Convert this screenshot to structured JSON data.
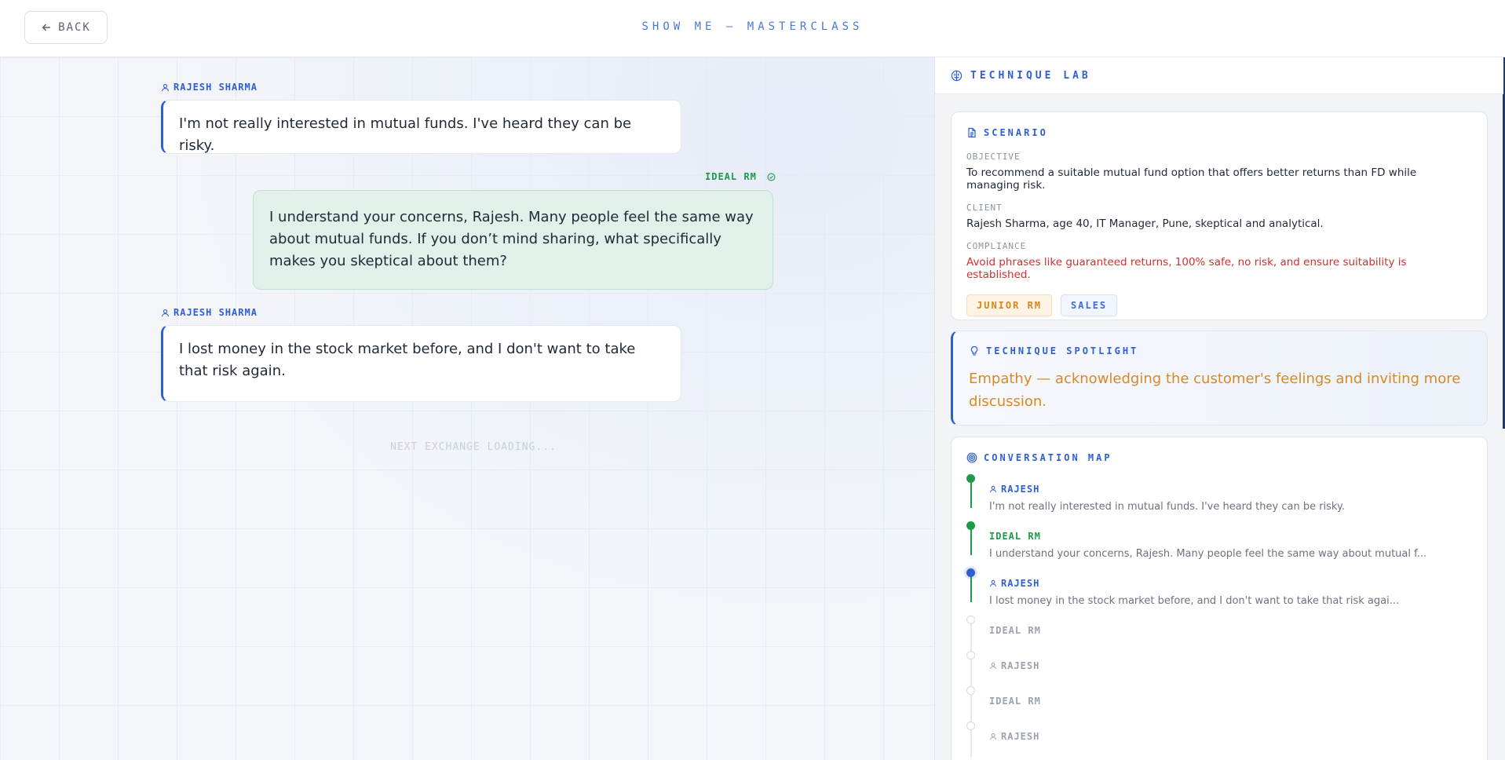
{
  "header": {
    "back_label": "BACK",
    "title": "SHOW ME — MASTERCLASS"
  },
  "chat": {
    "messages": [
      {
        "speaker": "RAJESH SHARMA",
        "role": "client",
        "text": "I'm not really interested in mutual funds. I've heard they can be risky."
      },
      {
        "speaker": "IDEAL RM",
        "role": "rm",
        "text": "I understand your concerns, Rajesh. Many people feel the same way about mutual funds. If you don’t mind sharing, what specifically makes you skeptical about them?"
      },
      {
        "speaker": "RAJESH SHARMA",
        "role": "client",
        "text": "I lost money in the stock market before, and I don't want to take that risk again."
      }
    ],
    "loading_text": "NEXT EXCHANGE LOADING..."
  },
  "panel": {
    "title": "TECHNIQUE LAB",
    "scenario": {
      "title": "SCENARIO",
      "objective_label": "OBJECTIVE",
      "objective": "To recommend a suitable mutual fund option that offers better returns than FD while managing risk.",
      "client_label": "CLIENT",
      "client": "Rajesh Sharma, age 40, IT Manager, Pune, skeptical and analytical.",
      "compliance_label": "COMPLIANCE",
      "compliance": "Avoid phrases like guaranteed returns, 100% safe, no risk, and ensure suitability is established.",
      "tags": [
        "JUNIOR RM",
        "SALES"
      ]
    },
    "spotlight": {
      "title": "TECHNIQUE SPOTLIGHT",
      "text": "Empathy — acknowledging the customer's feelings and inviting more discussion."
    },
    "map": {
      "title": "CONVERSATION MAP",
      "items": [
        {
          "speaker": "RAJESH",
          "text": "I'm not really interested in mutual funds. I've heard they can be risky.",
          "state": "done"
        },
        {
          "speaker": "IDEAL RM",
          "text": "I understand your concerns, Rajesh. Many people feel the same way about mutual f...",
          "state": "done"
        },
        {
          "speaker": "RAJESH",
          "text": "I lost money in the stock market before, and I don't want to take that risk agai...",
          "state": "current"
        },
        {
          "speaker": "IDEAL RM",
          "state": "pending"
        },
        {
          "speaker": "RAJESH",
          "state": "pending"
        },
        {
          "speaker": "IDEAL RM",
          "state": "pending"
        },
        {
          "speaker": "RAJESH",
          "state": "pending"
        }
      ]
    }
  },
  "colors": {
    "accent_blue": "#2f5fcf",
    "rm_green": "#1c9a4a",
    "spotlight_orange": "#d98a1f",
    "compliance_red": "#d32f2f"
  }
}
